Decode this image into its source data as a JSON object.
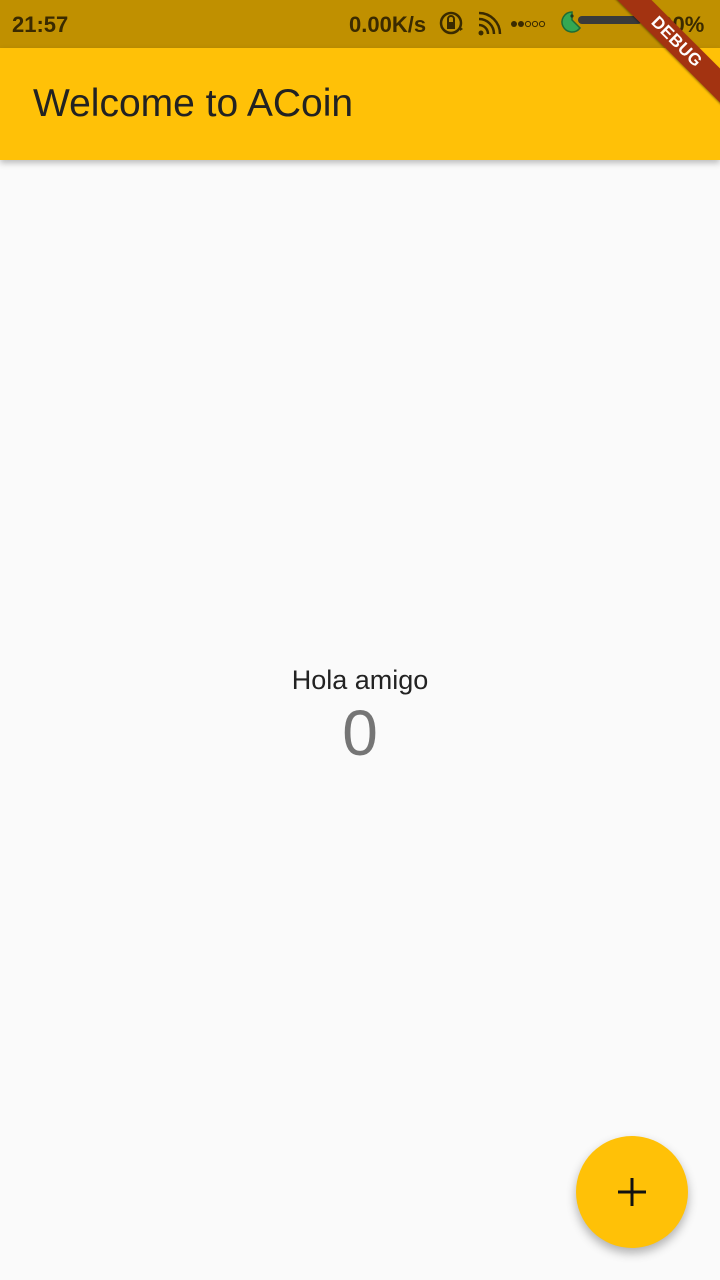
{
  "status_bar": {
    "time": "21:57",
    "network_speed": "0.00K/s",
    "battery": "100%",
    "icons": [
      "lock-rotate-icon",
      "cast-icon",
      "signal-strength-icon",
      "battery-icon"
    ]
  },
  "app_bar": {
    "title": "Welcome to ACoin"
  },
  "debug_banner": {
    "label": "DEBUG"
  },
  "body": {
    "greeting": "Hola amigo",
    "counter": "0"
  },
  "fab": {
    "icon": "plus-icon"
  },
  "colors": {
    "primary": "#ffc107",
    "status_bar": "#c09000",
    "background": "#fafafa",
    "debug_banner": "#a33311",
    "counter_text": "#757575"
  }
}
